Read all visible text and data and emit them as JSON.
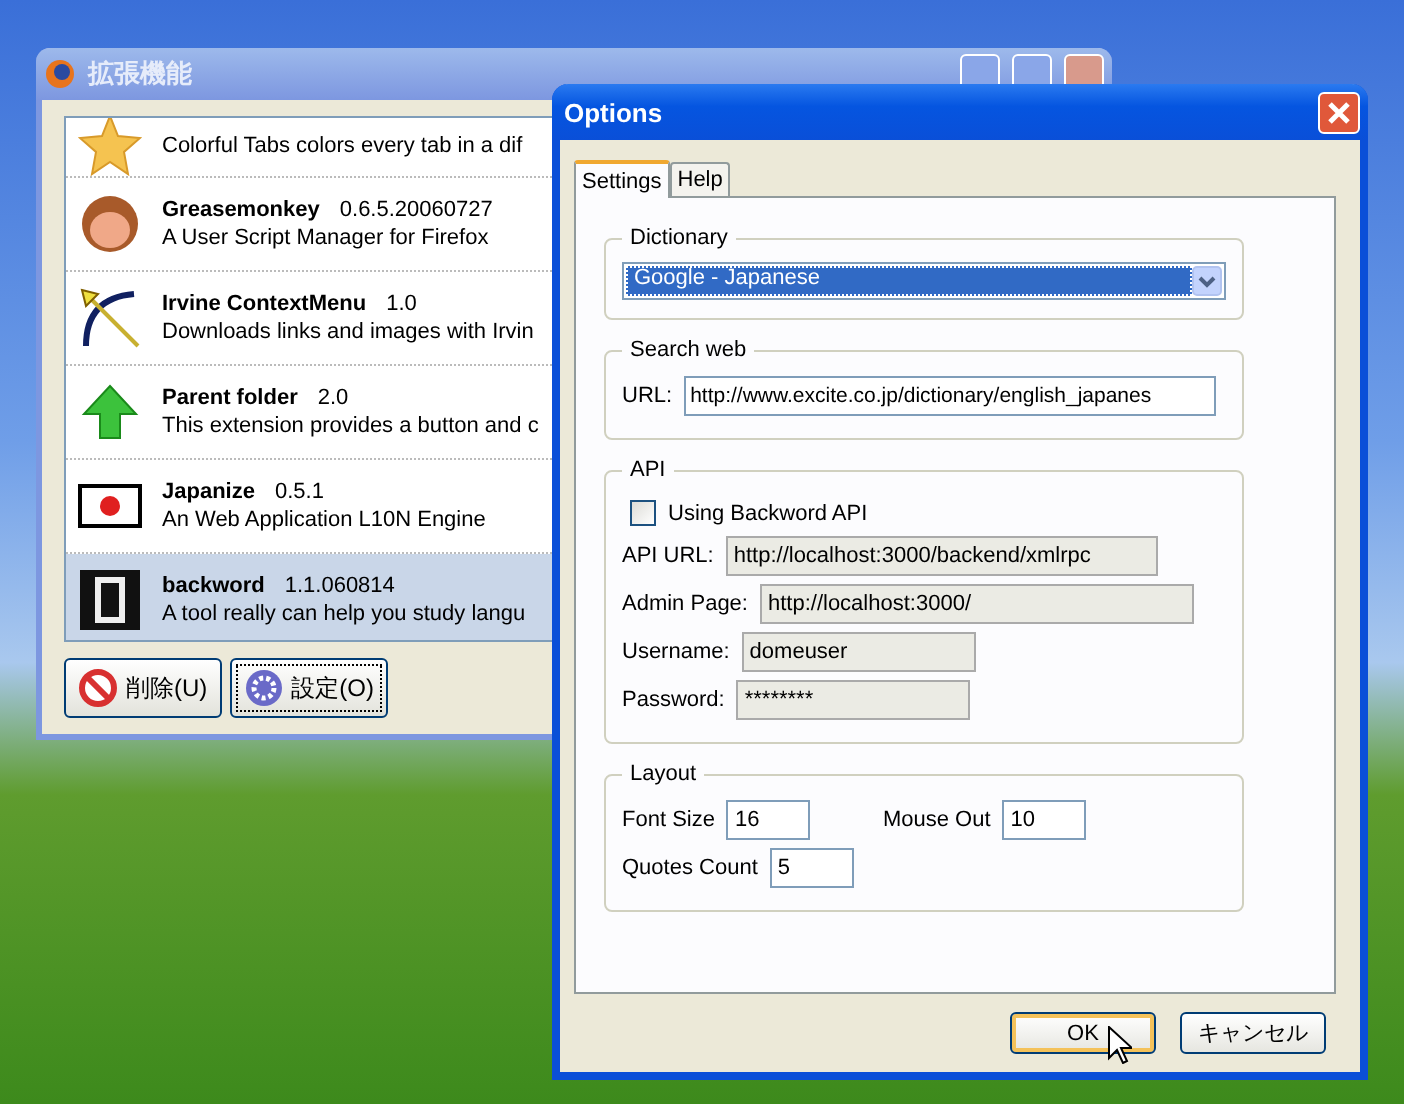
{
  "extensions_window": {
    "title": "拡張機能",
    "extensions": [
      {
        "kind": "star",
        "description": "Colorful Tabs colors every tab in a dif",
        "selected": false
      },
      {
        "kind": "monkey",
        "name": "Greasemonkey",
        "version": "0.6.5.20060727",
        "description": "A User Script Manager for Firefox",
        "selected": false
      },
      {
        "kind": "bow",
        "name": "Irvine ContextMenu",
        "version": "1.0",
        "description": "Downloads links and images with Irvin",
        "selected": false
      },
      {
        "kind": "arrow",
        "name": "Parent folder",
        "version": "2.0",
        "description": "This extension provides a button and c",
        "selected": false
      },
      {
        "kind": "flag",
        "name": "Japanize",
        "version": "0.5.1",
        "description": "An Web Application L10N Engine",
        "selected": false
      },
      {
        "kind": "logo",
        "name": "backword",
        "version": "1.1.060814",
        "description": "A tool really can help you study langu",
        "selected": true
      }
    ],
    "buttons": [
      {
        "kind": "uninstall",
        "label": "削除(U)",
        "focused": false
      },
      {
        "kind": "options",
        "label": "設定(O)",
        "focused": true
      }
    ]
  },
  "options_dialog": {
    "title": "Options",
    "tabs": [
      {
        "label": "Settings",
        "selected": true
      },
      {
        "label": "Help",
        "selected": false
      }
    ],
    "dictionary": {
      "legend": "Dictionary",
      "value": "Google - Japanese"
    },
    "search_web": {
      "legend": "Search web",
      "label": "URL:",
      "value": "http://www.excite.co.jp/dictionary/english_japanes"
    },
    "api": {
      "legend": "API",
      "checkbox_label": "Using Backword API",
      "checked": false,
      "fields": [
        {
          "label": "API URL:",
          "value": "http://localhost:3000/backend/xmlrpc",
          "disabled": true
        },
        {
          "label": "Admin Page:",
          "value": "http://localhost:3000/",
          "disabled": true
        },
        {
          "label": "Username:",
          "value": "domeuser",
          "disabled": true
        },
        {
          "label": "Password:",
          "value": "********",
          "disabled": true
        }
      ]
    },
    "layout": {
      "legend": "Layout",
      "fields": [
        {
          "label": "Font Size",
          "value": "16"
        },
        {
          "label": "Mouse Out",
          "value": "10"
        },
        {
          "label": "Quotes Count",
          "value": "5"
        }
      ]
    },
    "buttons": [
      {
        "label": "OK",
        "default": true
      },
      {
        "label": "キャンセル",
        "default": false
      }
    ]
  }
}
